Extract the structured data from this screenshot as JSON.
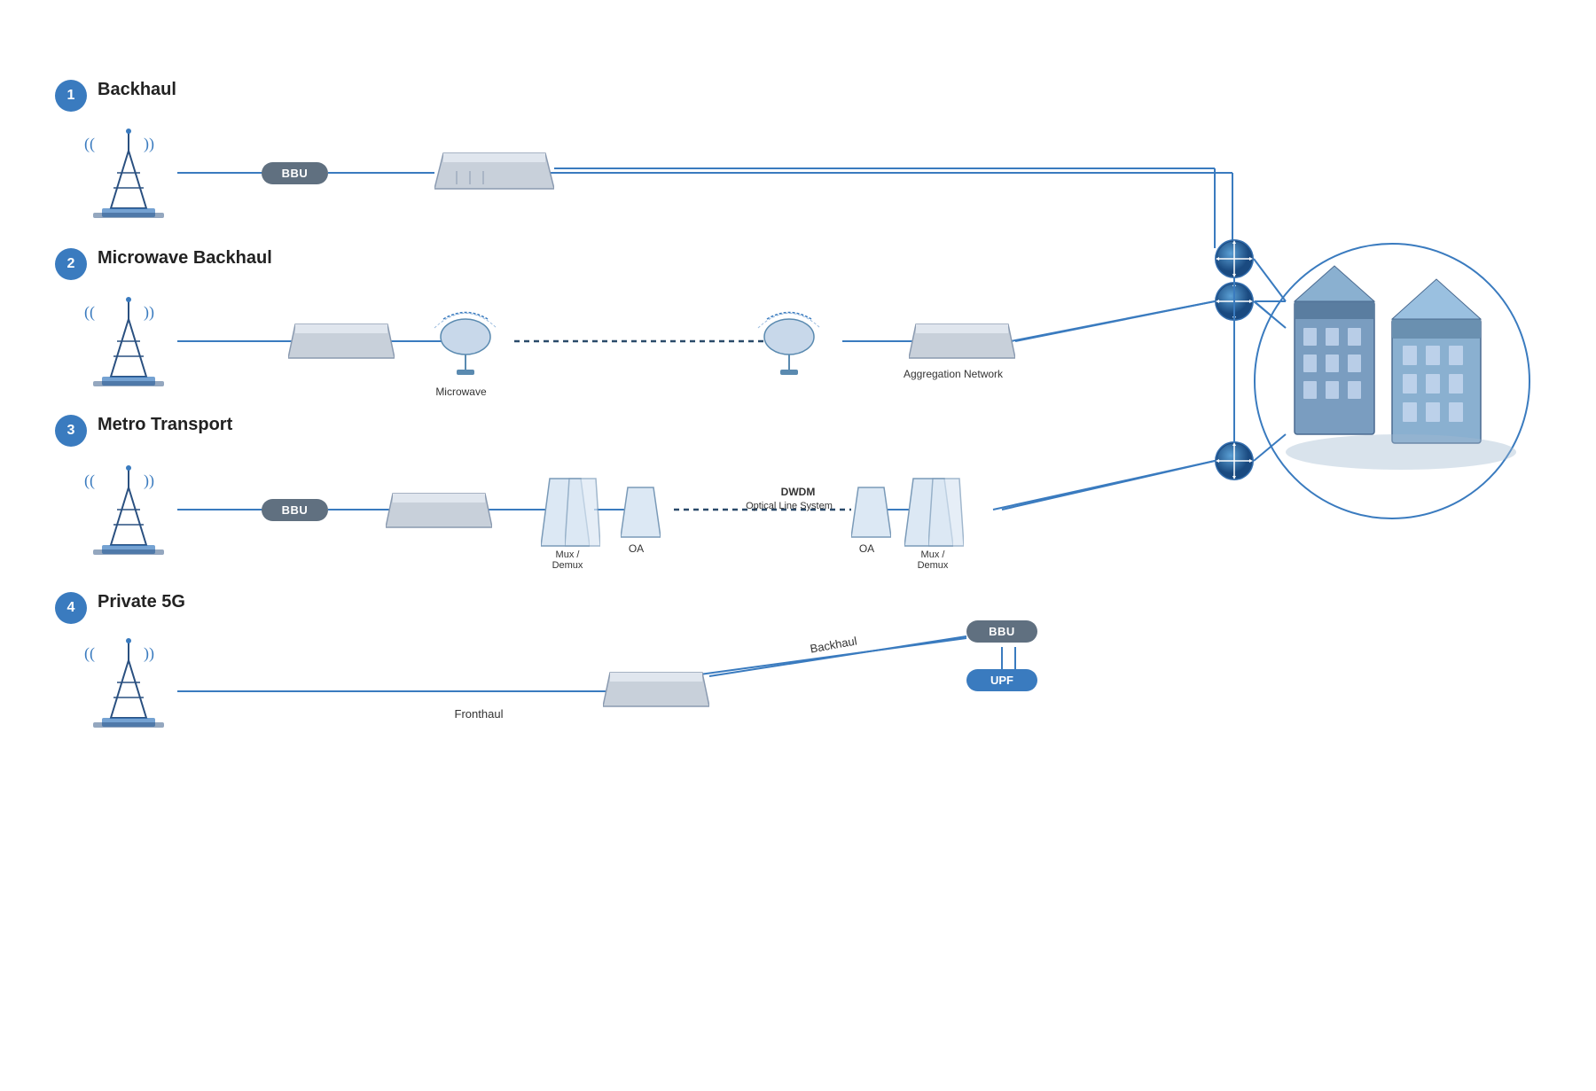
{
  "sections": [
    {
      "number": "1",
      "label": "Backhaul"
    },
    {
      "number": "2",
      "label": "Microwave Backhaul"
    },
    {
      "number": "3",
      "label": "Metro Transport"
    },
    {
      "number": "4",
      "label": "Private 5G"
    }
  ],
  "badges": {
    "color": "#3a7bbf"
  },
  "elements": {
    "bbu_label": "BBU",
    "upf_label": "UPF",
    "microwave_label": "Microwave",
    "aggregation_label": "Aggregation Network",
    "dwdm_label": "DWDM",
    "optical_label": "Optical Line System",
    "mux_demux_left_label": "Mux /\nDemux",
    "oa_left_label": "OA",
    "oa_right_label": "OA",
    "mux_demux_right_label": "Mux /\nDemux",
    "fronthaul_label": "Fronthaul",
    "backhaul_label": "Backhaul"
  }
}
